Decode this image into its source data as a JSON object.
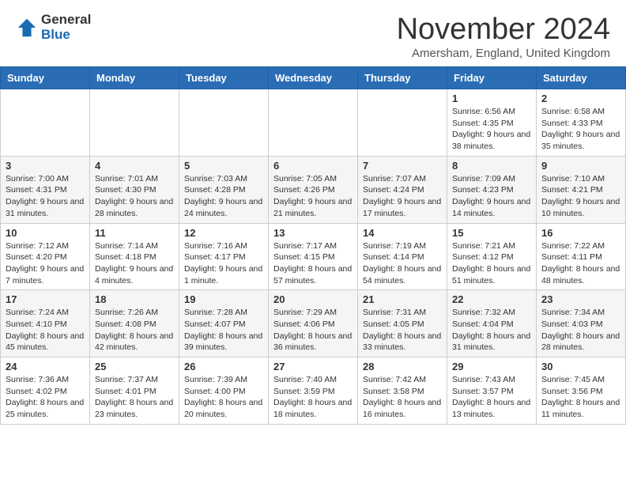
{
  "logo": {
    "general": "General",
    "blue": "Blue"
  },
  "title": {
    "month": "November 2024",
    "location": "Amersham, England, United Kingdom"
  },
  "weekdays": [
    "Sunday",
    "Monday",
    "Tuesday",
    "Wednesday",
    "Thursday",
    "Friday",
    "Saturday"
  ],
  "weeks": [
    [
      {
        "day": "",
        "info": ""
      },
      {
        "day": "",
        "info": ""
      },
      {
        "day": "",
        "info": ""
      },
      {
        "day": "",
        "info": ""
      },
      {
        "day": "",
        "info": ""
      },
      {
        "day": "1",
        "info": "Sunrise: 6:56 AM\nSunset: 4:35 PM\nDaylight: 9 hours and 38 minutes."
      },
      {
        "day": "2",
        "info": "Sunrise: 6:58 AM\nSunset: 4:33 PM\nDaylight: 9 hours and 35 minutes."
      }
    ],
    [
      {
        "day": "3",
        "info": "Sunrise: 7:00 AM\nSunset: 4:31 PM\nDaylight: 9 hours and 31 minutes."
      },
      {
        "day": "4",
        "info": "Sunrise: 7:01 AM\nSunset: 4:30 PM\nDaylight: 9 hours and 28 minutes."
      },
      {
        "day": "5",
        "info": "Sunrise: 7:03 AM\nSunset: 4:28 PM\nDaylight: 9 hours and 24 minutes."
      },
      {
        "day": "6",
        "info": "Sunrise: 7:05 AM\nSunset: 4:26 PM\nDaylight: 9 hours and 21 minutes."
      },
      {
        "day": "7",
        "info": "Sunrise: 7:07 AM\nSunset: 4:24 PM\nDaylight: 9 hours and 17 minutes."
      },
      {
        "day": "8",
        "info": "Sunrise: 7:09 AM\nSunset: 4:23 PM\nDaylight: 9 hours and 14 minutes."
      },
      {
        "day": "9",
        "info": "Sunrise: 7:10 AM\nSunset: 4:21 PM\nDaylight: 9 hours and 10 minutes."
      }
    ],
    [
      {
        "day": "10",
        "info": "Sunrise: 7:12 AM\nSunset: 4:20 PM\nDaylight: 9 hours and 7 minutes."
      },
      {
        "day": "11",
        "info": "Sunrise: 7:14 AM\nSunset: 4:18 PM\nDaylight: 9 hours and 4 minutes."
      },
      {
        "day": "12",
        "info": "Sunrise: 7:16 AM\nSunset: 4:17 PM\nDaylight: 9 hours and 1 minute."
      },
      {
        "day": "13",
        "info": "Sunrise: 7:17 AM\nSunset: 4:15 PM\nDaylight: 8 hours and 57 minutes."
      },
      {
        "day": "14",
        "info": "Sunrise: 7:19 AM\nSunset: 4:14 PM\nDaylight: 8 hours and 54 minutes."
      },
      {
        "day": "15",
        "info": "Sunrise: 7:21 AM\nSunset: 4:12 PM\nDaylight: 8 hours and 51 minutes."
      },
      {
        "day": "16",
        "info": "Sunrise: 7:22 AM\nSunset: 4:11 PM\nDaylight: 8 hours and 48 minutes."
      }
    ],
    [
      {
        "day": "17",
        "info": "Sunrise: 7:24 AM\nSunset: 4:10 PM\nDaylight: 8 hours and 45 minutes."
      },
      {
        "day": "18",
        "info": "Sunrise: 7:26 AM\nSunset: 4:08 PM\nDaylight: 8 hours and 42 minutes."
      },
      {
        "day": "19",
        "info": "Sunrise: 7:28 AM\nSunset: 4:07 PM\nDaylight: 8 hours and 39 minutes."
      },
      {
        "day": "20",
        "info": "Sunrise: 7:29 AM\nSunset: 4:06 PM\nDaylight: 8 hours and 36 minutes."
      },
      {
        "day": "21",
        "info": "Sunrise: 7:31 AM\nSunset: 4:05 PM\nDaylight: 8 hours and 33 minutes."
      },
      {
        "day": "22",
        "info": "Sunrise: 7:32 AM\nSunset: 4:04 PM\nDaylight: 8 hours and 31 minutes."
      },
      {
        "day": "23",
        "info": "Sunrise: 7:34 AM\nSunset: 4:03 PM\nDaylight: 8 hours and 28 minutes."
      }
    ],
    [
      {
        "day": "24",
        "info": "Sunrise: 7:36 AM\nSunset: 4:02 PM\nDaylight: 8 hours and 25 minutes."
      },
      {
        "day": "25",
        "info": "Sunrise: 7:37 AM\nSunset: 4:01 PM\nDaylight: 8 hours and 23 minutes."
      },
      {
        "day": "26",
        "info": "Sunrise: 7:39 AM\nSunset: 4:00 PM\nDaylight: 8 hours and 20 minutes."
      },
      {
        "day": "27",
        "info": "Sunrise: 7:40 AM\nSunset: 3:59 PM\nDaylight: 8 hours and 18 minutes."
      },
      {
        "day": "28",
        "info": "Sunrise: 7:42 AM\nSunset: 3:58 PM\nDaylight: 8 hours and 16 minutes."
      },
      {
        "day": "29",
        "info": "Sunrise: 7:43 AM\nSunset: 3:57 PM\nDaylight: 8 hours and 13 minutes."
      },
      {
        "day": "30",
        "info": "Sunrise: 7:45 AM\nSunset: 3:56 PM\nDaylight: 8 hours and 11 minutes."
      }
    ]
  ]
}
